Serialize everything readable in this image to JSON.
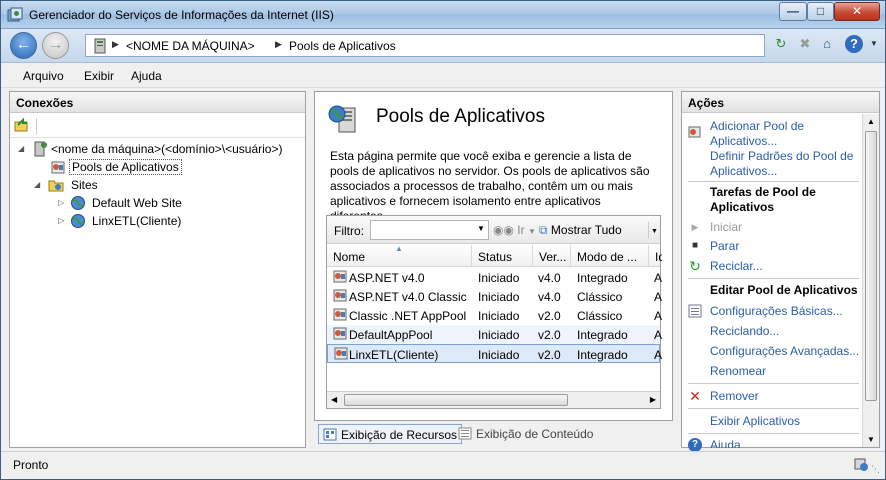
{
  "window": {
    "title": "Gerenciador do Serviços de Informações da Internet (IIS)",
    "buttons": {
      "minimize": "—",
      "maximize": "□",
      "close": "✕"
    }
  },
  "address": {
    "crumbs": [
      "<NOME DA MÁQUINA>",
      "Pools de Aplicativos"
    ]
  },
  "menu": [
    "Arquivo",
    "Exibir",
    "Ajuda"
  ],
  "connections": {
    "title": "Conexões",
    "tree": [
      {
        "label": "<nome da máquina>(<domínio>\\<usuário>)",
        "icon": "server-icon"
      },
      {
        "label": "Pools de Aplicativos",
        "icon": "app-pool-icon"
      },
      {
        "label": "Sites",
        "icon": "sites-folder-icon"
      },
      {
        "label": "Default Web Site",
        "icon": "globe-icon"
      },
      {
        "label": "LinxETL(Cliente)",
        "icon": "globe-icon"
      }
    ]
  },
  "feature": {
    "title": "Pools de Aplicativos",
    "description": "Esta página permite que você exiba e gerencie a lista de pools de aplicativos no servidor. Os pools de aplicativos são associados a processos de trabalho, contêm um ou mais aplicativos e fornecem isolamento entre aplicativos diferentes."
  },
  "filter": {
    "label": "Filtro:",
    "go": "Ir",
    "show_all": "Mostrar Tudo"
  },
  "grid": {
    "columns": [
      "Nome",
      "Status",
      "Ver...",
      "Modo de ...",
      "Id"
    ],
    "rows": [
      [
        "ASP.NET v4.0",
        "Iniciado",
        "v4.0",
        "Integrado",
        "A"
      ],
      [
        "ASP.NET v4.0 Classic",
        "Iniciado",
        "v4.0",
        "Clássico",
        "A"
      ],
      [
        "Classic .NET AppPool",
        "Iniciado",
        "v2.0",
        "Clássico",
        "A"
      ],
      [
        "DefaultAppPool",
        "Iniciado",
        "v2.0",
        "Integrado",
        "A"
      ],
      [
        "LinxETL(Cliente)",
        "Iniciado",
        "v2.0",
        "Integrado",
        "A"
      ]
    ]
  },
  "view_tabs": [
    "Exibição de Recursos",
    "Exibição de Conteúdo"
  ],
  "actions": {
    "title": "Ações",
    "add_pool": "Adicionar Pool de Aplicativos...",
    "defaults": "Definir Padrões do Pool de Aplicativos...",
    "tasks_head": "Tarefas de Pool de Aplicativos",
    "start": "Iniciar",
    "stop": "Parar",
    "recycle": "Reciclar...",
    "edit_head": "Editar Pool de Aplicativos",
    "basic": "Configurações Básicas...",
    "recycling": "Reciclando...",
    "advanced": "Configurações Avançadas...",
    "rename": "Renomear",
    "remove": "Remover",
    "view_apps": "Exibir Aplicativos",
    "help": "Ajuda"
  },
  "status": "Pronto",
  "colors": {
    "link": "#2a5ea8",
    "selection": "#dce9f8",
    "close": "#c94a34"
  }
}
